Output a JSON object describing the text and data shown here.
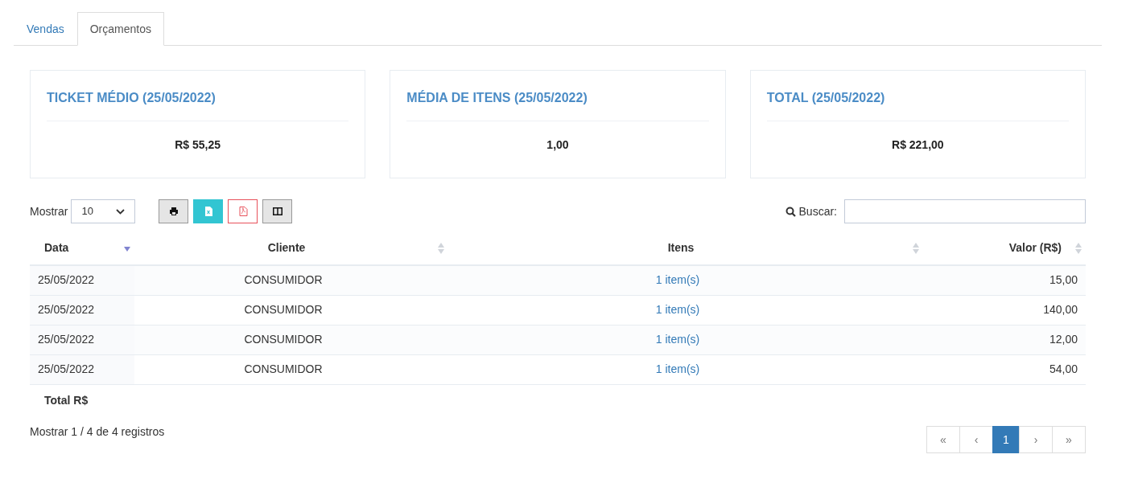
{
  "tabs": [
    {
      "label": "Vendas",
      "selected": false
    },
    {
      "label": "Orçamentos",
      "selected": true
    }
  ],
  "cards": [
    {
      "title": "TICKET MÉDIO (25/05/2022)",
      "value": "R$ 55,25"
    },
    {
      "title": "MÉDIA DE ITENS (25/05/2022)",
      "value": "1,00"
    },
    {
      "title": "TOTAL (25/05/2022)",
      "value": "R$ 221,00"
    }
  ],
  "length_menu": {
    "label": "Mostrar",
    "value": "10"
  },
  "export_buttons": [
    {
      "kind": "print"
    },
    {
      "kind": "excel"
    },
    {
      "kind": "pdf"
    },
    {
      "kind": "columns"
    }
  ],
  "search": {
    "label": "Buscar:"
  },
  "table": {
    "columns": [
      {
        "label": "Data",
        "sorted": true
      },
      {
        "label": "Cliente",
        "sorted": false
      },
      {
        "label": "Itens",
        "sorted": false
      },
      {
        "label": "Valor (R$)",
        "sorted": false
      }
    ],
    "rows": [
      [
        "25/05/2022",
        "CONSUMIDOR",
        "1 item(s)",
        "15,00"
      ],
      [
        "25/05/2022",
        "CONSUMIDOR",
        "1 item(s)",
        "140,00"
      ],
      [
        "25/05/2022",
        "CONSUMIDOR",
        "1 item(s)",
        "12,00"
      ],
      [
        "25/05/2022",
        "CONSUMIDOR",
        "1 item(s)",
        "54,00"
      ]
    ],
    "footer": "Total R$"
  },
  "info": "Mostrar 1 / 4 de 4 registros",
  "pagination": [
    {
      "label": "«",
      "selected": false
    },
    {
      "label": "‹",
      "selected": false
    },
    {
      "label": "1",
      "selected": true
    },
    {
      "label": "›",
      "selected": false
    },
    {
      "label": "»",
      "selected": false
    }
  ]
}
